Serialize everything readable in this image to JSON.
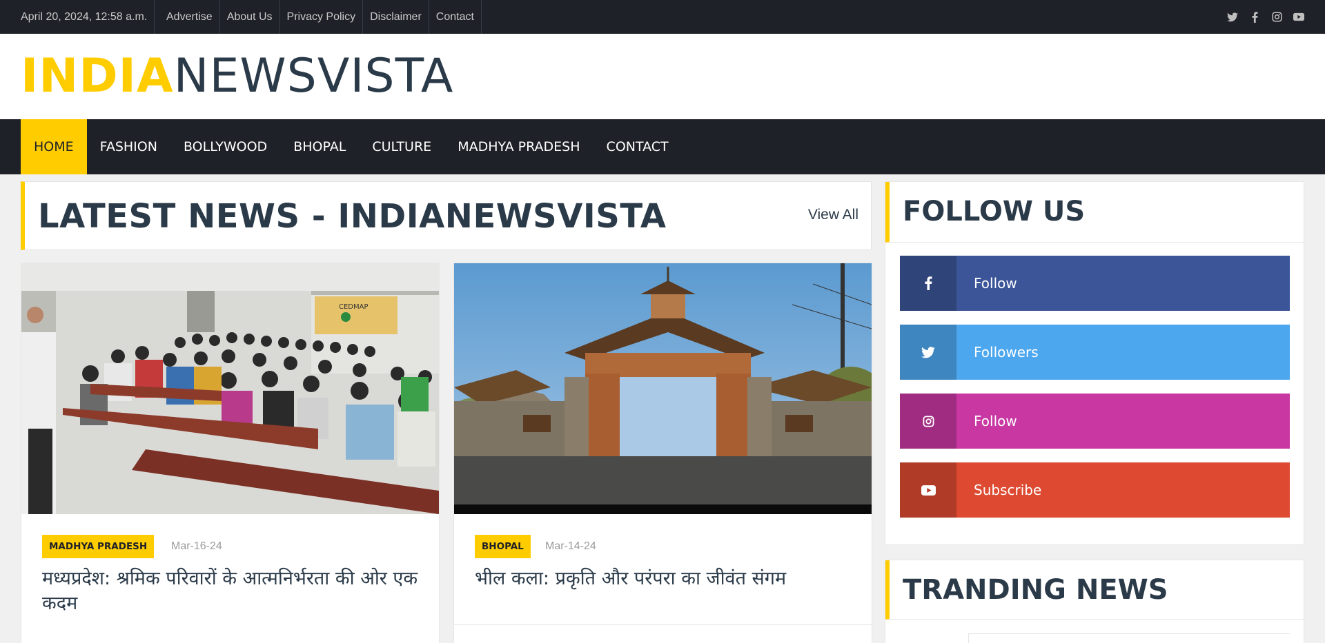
{
  "topbar": {
    "date": "April 20, 2024, 12:58 a.m.",
    "links": [
      "Advertise",
      "About Us",
      "Privacy Policy",
      "Disclaimer",
      "Contact"
    ],
    "social_icons": [
      "twitter-icon",
      "facebook-icon",
      "instagram-icon",
      "youtube-icon"
    ]
  },
  "header": {
    "logo_part1": "INDIA",
    "logo_part2": "NEWSVISTA"
  },
  "nav": {
    "items": [
      "HOME",
      "FASHION",
      "BOLLYWOOD",
      "BHOPAL",
      "CULTURE",
      "MADHYA PRADESH",
      "CONTACT"
    ],
    "active": "HOME"
  },
  "latest": {
    "heading": "LATEST NEWS - INDIANEWSVISTA",
    "view_all": "View All"
  },
  "articles": [
    {
      "category": "MADHYA PRADESH",
      "date": "Mar-16-24",
      "title": "मध्यप्रदेश: श्रमिक परिवारों के आत्मनिर्भरता की ओर एक कदम",
      "banner_text": "CEDMAP",
      "image": "classroom-photo"
    },
    {
      "category": "BHOPAL",
      "date": "Mar-14-24",
      "title": "भील कला: प्रकृति और परंपरा का जीवंत संगम",
      "image": "gateway-photo"
    }
  ],
  "follow": {
    "heading": "FOLLOW US",
    "buttons": [
      {
        "label": "Follow",
        "icon": "facebook-icon",
        "color": "#3b5598",
        "icon_bg": "#2f4478"
      },
      {
        "label": "Followers",
        "icon": "twitter-icon",
        "color": "#4da7ee",
        "icon_bg": "#3e86c0"
      },
      {
        "label": "Follow",
        "icon": "instagram-icon",
        "color": "#c837a2",
        "icon_bg": "#a02c82"
      },
      {
        "label": "Subscribe",
        "icon": "youtube-icon",
        "color": "#dd4a31",
        "icon_bg": "#b03b27"
      }
    ]
  },
  "trending": {
    "heading": "TRANDING NEWS"
  },
  "colors": {
    "accent": "#ffcc00",
    "dark": "#1f2128",
    "text": "#2b3a48"
  }
}
